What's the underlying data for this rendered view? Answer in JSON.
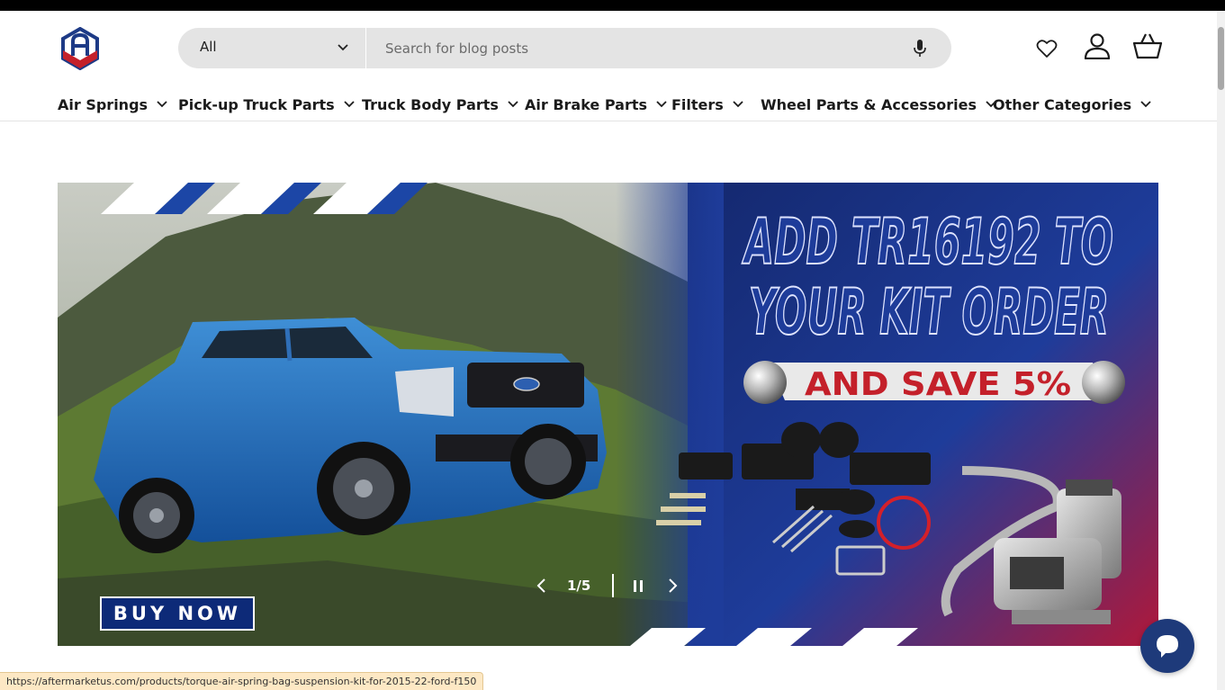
{
  "header": {
    "search": {
      "category_selected": "All",
      "placeholder": "Search for blog posts",
      "value": ""
    },
    "icons": [
      "heart-icon",
      "account-icon",
      "basket-icon",
      "microphone-icon"
    ]
  },
  "nav": {
    "items": [
      {
        "label": "Air Springs"
      },
      {
        "label": "Pick-up Truck Parts"
      },
      {
        "label": "Truck Body Parts"
      },
      {
        "label": "Air Brake Parts"
      },
      {
        "label": "Filters"
      },
      {
        "label": "Wheel Parts & Accessories"
      },
      {
        "label": "Other Categories"
      }
    ]
  },
  "hero": {
    "headline_line1": "ADD TR16192 TO",
    "headline_line2": "YOUR KIT ORDER",
    "promo": "AND SAVE 5%",
    "cta_label": "BUY NOW",
    "slide_counter": "1/5"
  },
  "status_bar": {
    "url": "https://aftermarketus.com/products/torque-air-spring-bag-suspension-kit-for-2015-22-ford-f150"
  },
  "colors": {
    "brand_navy": "#0d2a78",
    "brand_red": "#c4202a",
    "search_bg": "#e4e4e4",
    "chat_bubble": "#1e3a7a"
  }
}
